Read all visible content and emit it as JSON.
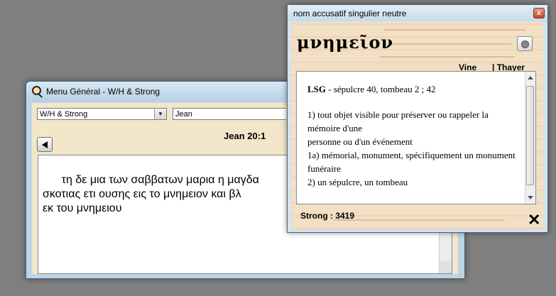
{
  "main_window": {
    "title": "Menu Général - W/H & Strong",
    "version_select": "W/H & Strong",
    "book_select": "Jean",
    "reference": "Jean 20:1",
    "greek_text": "τη δε μια των σαββατων μαρια η μαγδα\nσκοτιας ετι ουσης εις το μνημειον και βλ\nεκ του μνημειου"
  },
  "popup": {
    "title": "nom accusatif singulier neutre",
    "close_label": "x",
    "headword": "μνημεῖον",
    "link_vine": "Vine",
    "link_thayer": "| Thayer",
    "lsg_label": "LSG",
    "lsg_text": " - sépulcre 40, tombeau 2 ; 42",
    "definition_lines": [
      "1) tout objet visible pour préserver ou rappeler la mémoire d'une",
      "personne ou d'un événement",
      "1a) mémorial, monument, spécifiquement un monument funéraire",
      "2) un sépulcre, un tombeau"
    ],
    "strong_label": "Strong : 3419",
    "close_x": "✕"
  }
}
